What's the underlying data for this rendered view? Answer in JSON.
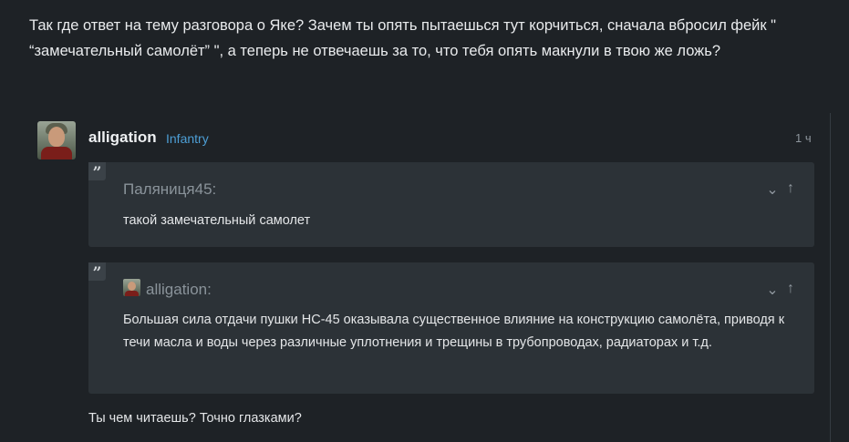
{
  "post": {
    "text": "Так где ответ на тему разговора о Яке? Зачем ты опять пытаешься тут корчиться, сначала вбросил фейк \" “замечательный самолёт” \", а теперь не отвечаешь за то, что тебя опять макнули в твою же ложь?"
  },
  "comment": {
    "author": "alligation",
    "rank": "Infantry",
    "time": "1 ч",
    "quotes": [
      {
        "author": "Паляниця45:",
        "text": "такой замечательный самолет"
      },
      {
        "author": "alligation:",
        "text": "Большая сила отдачи пушки НС-45 оказывала существенное влияние на конструкцию самолёта, приводя к течи масла и воды через различные уплотнения и трещины в трубопроводах, радиаторах и т.д."
      }
    ],
    "reply": "Ты чем читаешь? Точно глазками?"
  },
  "icons": {
    "quote": "quote-icon",
    "expand": "chevron-down-icon",
    "goto": "arrow-up-icon"
  },
  "colors": {
    "background": "#1e2226",
    "quote_bg": "#2c3237",
    "rank": "#4d9fd6"
  }
}
